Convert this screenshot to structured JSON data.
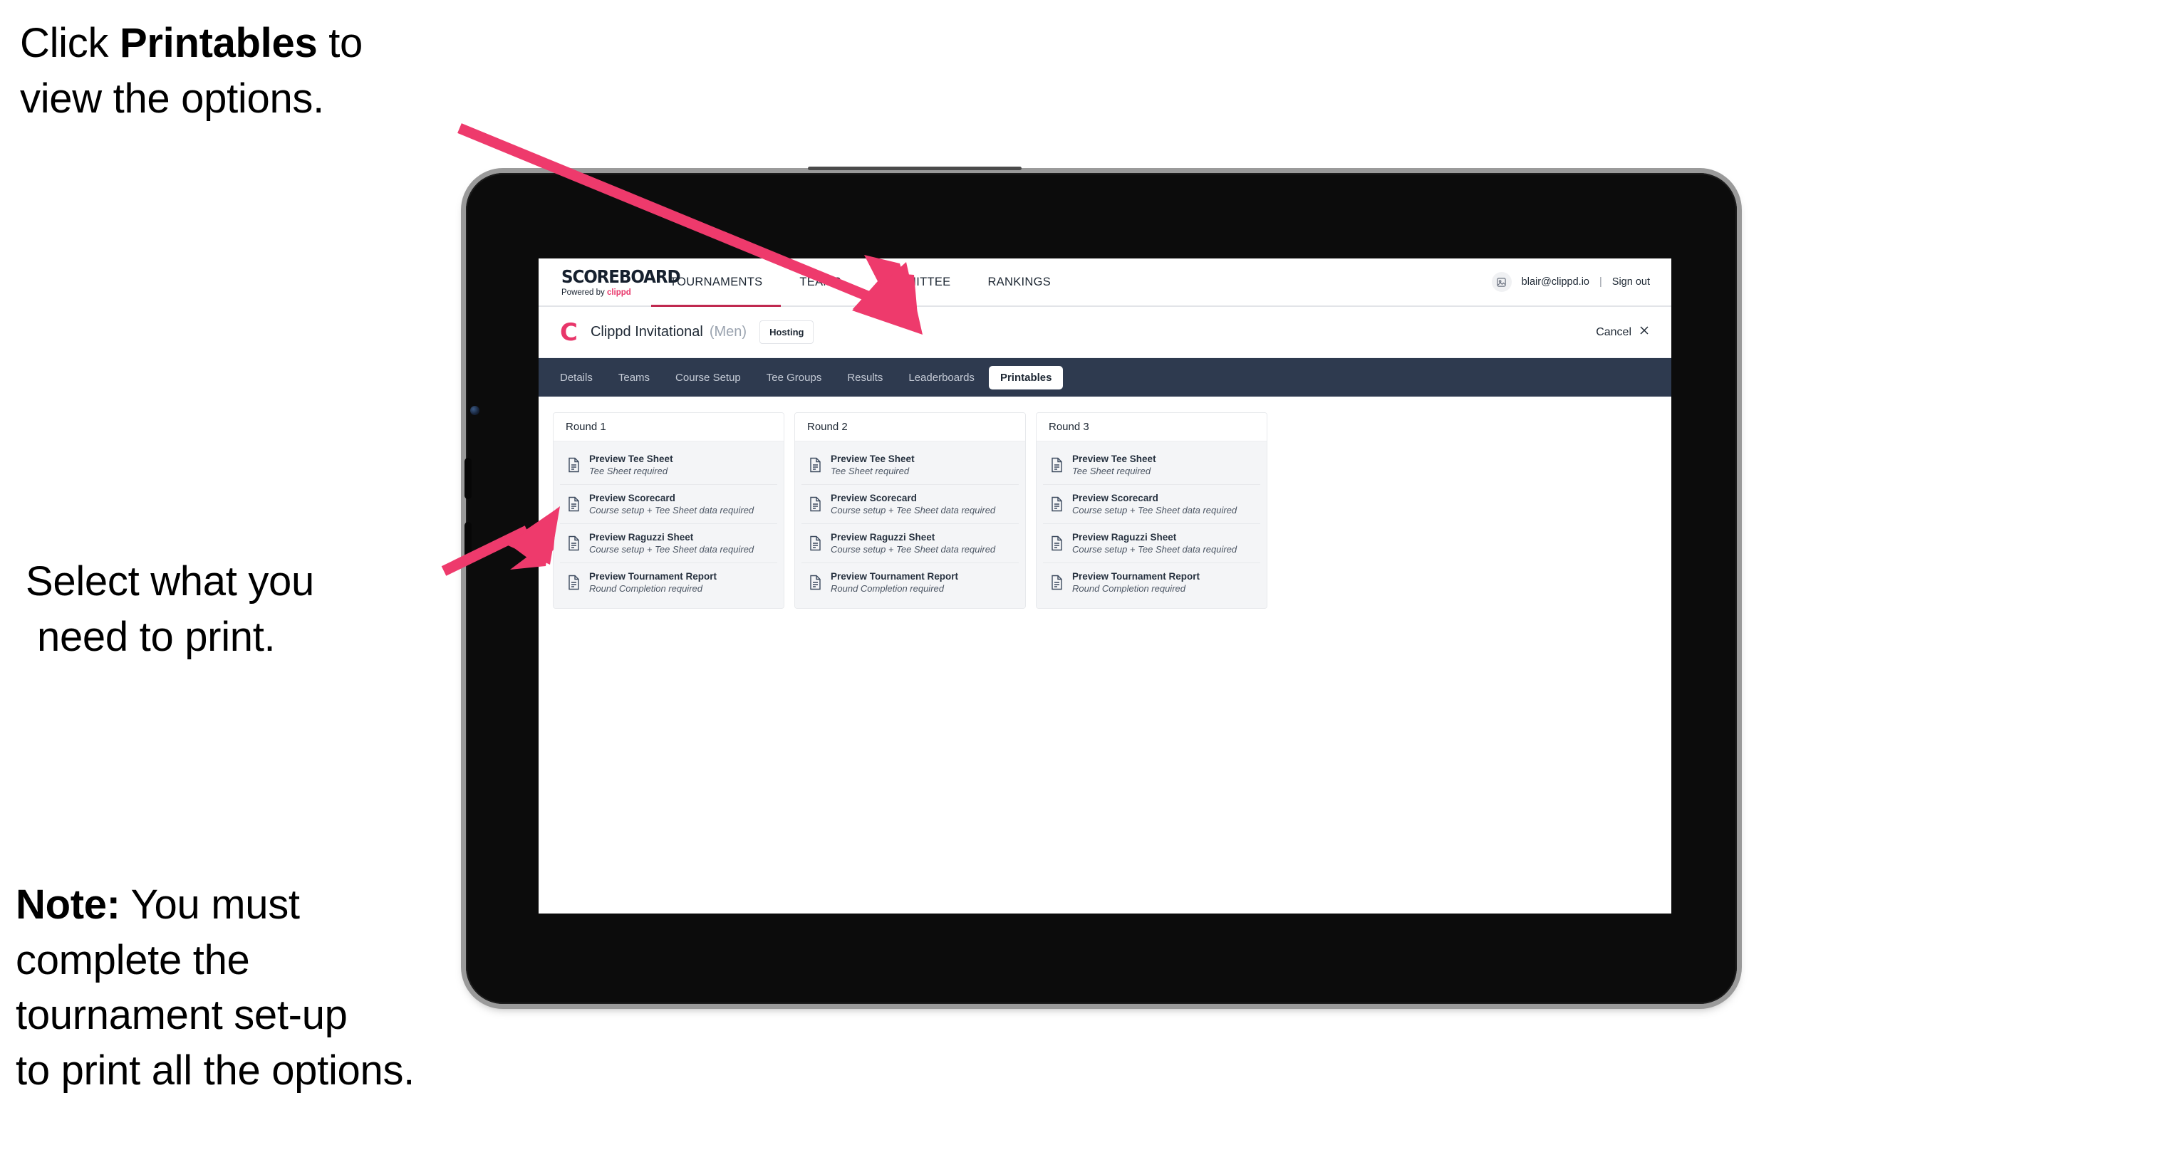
{
  "annotations": {
    "click_printables": {
      "line1_pre": "Click ",
      "line1_bold": "Printables",
      "line1_post": " to",
      "line2": "view the options."
    },
    "select_print": {
      "line1": "Select what you",
      "line2": "need to print."
    },
    "note": {
      "bold": "Note:",
      "line1_rest": " You must",
      "line2": "complete the",
      "line3": "tournament set-up",
      "line4": "to print all the options."
    }
  },
  "colors": {
    "arrow_pink": "#ee3a6c",
    "brand_pink": "#e8366a",
    "tabstrip_navy": "#2e3a4f",
    "accent_underline": "#c0294f"
  },
  "app": {
    "brand": {
      "title": "SCOREBOARD",
      "sub_pre": "Powered by ",
      "sub_brand": "clippd"
    },
    "topnav": [
      {
        "label": "TOURNAMENTS",
        "active": true
      },
      {
        "label": "TEAMS",
        "active": false
      },
      {
        "label": "COMMITTEE",
        "active": false
      },
      {
        "label": "RANKINGS",
        "active": false
      }
    ],
    "account": {
      "email": "blair@clippd.io",
      "separator": "|",
      "sign_out": "Sign out",
      "avatar_icon": "user-avatar-icon"
    },
    "tournament": {
      "logo_letter": "C",
      "name": "Clippd Invitational",
      "gender": "(Men)",
      "status_badge": "Hosting",
      "cancel_label": "Cancel",
      "cancel_icon": "close-icon"
    },
    "tabs": [
      {
        "label": "Details",
        "active": false
      },
      {
        "label": "Teams",
        "active": false
      },
      {
        "label": "Course Setup",
        "active": false
      },
      {
        "label": "Tee Groups",
        "active": false
      },
      {
        "label": "Results",
        "active": false
      },
      {
        "label": "Leaderboards",
        "active": false
      },
      {
        "label": "Printables",
        "active": true
      }
    ],
    "rounds": [
      {
        "title": "Round 1",
        "items": [
          {
            "icon": "document-icon",
            "title": "Preview Tee Sheet",
            "subtitle": "Tee Sheet required"
          },
          {
            "icon": "document-icon",
            "title": "Preview Scorecard",
            "subtitle": "Course setup + Tee Sheet data required"
          },
          {
            "icon": "document-icon",
            "title": "Preview Raguzzi Sheet",
            "subtitle": "Course setup + Tee Sheet data required"
          },
          {
            "icon": "document-icon",
            "title": "Preview Tournament Report",
            "subtitle": "Round Completion required"
          }
        ]
      },
      {
        "title": "Round 2",
        "items": [
          {
            "icon": "document-icon",
            "title": "Preview Tee Sheet",
            "subtitle": "Tee Sheet required"
          },
          {
            "icon": "document-icon",
            "title": "Preview Scorecard",
            "subtitle": "Course setup + Tee Sheet data required"
          },
          {
            "icon": "document-icon",
            "title": "Preview Raguzzi Sheet",
            "subtitle": "Course setup + Tee Sheet data required"
          },
          {
            "icon": "document-icon",
            "title": "Preview Tournament Report",
            "subtitle": "Round Completion required"
          }
        ]
      },
      {
        "title": "Round 3",
        "items": [
          {
            "icon": "document-icon",
            "title": "Preview Tee Sheet",
            "subtitle": "Tee Sheet required"
          },
          {
            "icon": "document-icon",
            "title": "Preview Scorecard",
            "subtitle": "Course setup + Tee Sheet data required"
          },
          {
            "icon": "document-icon",
            "title": "Preview Raguzzi Sheet",
            "subtitle": "Course setup + Tee Sheet data required"
          },
          {
            "icon": "document-icon",
            "title": "Preview Tournament Report",
            "subtitle": "Round Completion required"
          }
        ]
      }
    ]
  }
}
